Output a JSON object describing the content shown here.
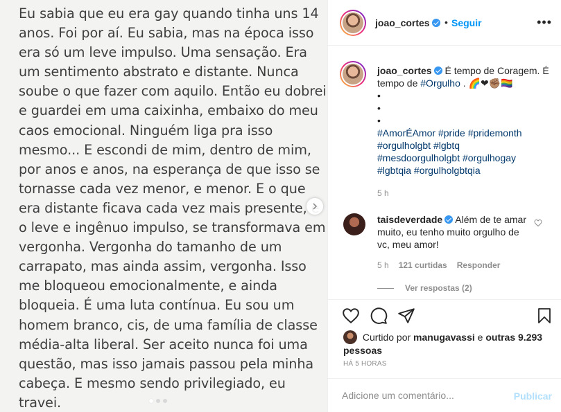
{
  "post_image": {
    "lines": [
      "Eu sabia que eu era gay quando tinha uns 14",
      "anos. Foi por aí. Eu sabia, mas na época isso",
      "era só um leve impulso.  Uma sensação. Era",
      "um sentimento abstrato e distante. Nunca",
      "soube o que fazer com aquilo. Então eu dobrei",
      "e guardei em uma caixinha, embaixo do meu",
      "caos emocional. Ninguém liga pra isso",
      "mesmo... E escondi de mim, dentro de mim,",
      "por anos e anos, na esperança de que isso se",
      "tornasse cada vez menor, e menor. E o que",
      "era distante ficava cada vez mais presente, e",
      "o leve e ingênuo impulso, se transformava em",
      "vergonha. Vergonha do tamanho de um",
      "carrapato, mas ainda assim, vergonha. Isso",
      "me bloqueou emocionalmente, e ainda",
      "bloqueia. É uma luta contínua. Eu sou um",
      "homem branco, cis, de uma família de classe",
      "média-alta liberal. Ser aceito nunca foi uma",
      "questão, mas isso jamais passou pela minha",
      "cabeça. E mesmo sendo privilegiado, eu",
      "travei."
    ],
    "next_icon": "chevron-right-icon",
    "dots_count": 3
  },
  "header": {
    "username": "joao_cortes",
    "separator": "•",
    "follow_label": "Seguir",
    "more_label": "•••"
  },
  "caption": {
    "username": "joao_cortes",
    "text": "É tempo de Coragem. É tempo de",
    "hashtag_orgulho": "#Orgulho",
    "after_hashtag": ".",
    "emojis": "🌈❤✊🏽🏳️‍🌈",
    "dots": [
      "•",
      "•",
      "•"
    ],
    "hashtags": [
      "#AmorÉAmor #pride #pridemonth",
      "#orgulholgbt #lgbtq",
      "#mesdoorgulholgbt #orgulhogay",
      "#lgbtqia #orgulholgbtqia"
    ],
    "time": "5 h"
  },
  "comment": {
    "username": "taisdeverdade",
    "text": "Além de te amar muito, eu tenho muito orgulho de vc, meu amor!",
    "time": "5 h",
    "likes": "121 curtidas",
    "reply_label": "Responder",
    "view_replies": "Ver respostas (2)"
  },
  "actions": {
    "icons": [
      "heart-icon",
      "comment-icon",
      "share-icon",
      "bookmark-icon"
    ]
  },
  "likes": {
    "prefix": "Curtido por",
    "user": "manugavassi",
    "connector": "e",
    "others": "outras 9.293 pessoas"
  },
  "posted_time": "HÁ 5 HORAS",
  "comment_box": {
    "placeholder": "Adicione um comentário...",
    "publish_label": "Publicar"
  },
  "colors": {
    "accent": "#0095f6",
    "link": "#00376b",
    "muted": "#8e8e8e",
    "publish_disabled": "#b2dffc",
    "image_bg": "#f3f3f2"
  }
}
